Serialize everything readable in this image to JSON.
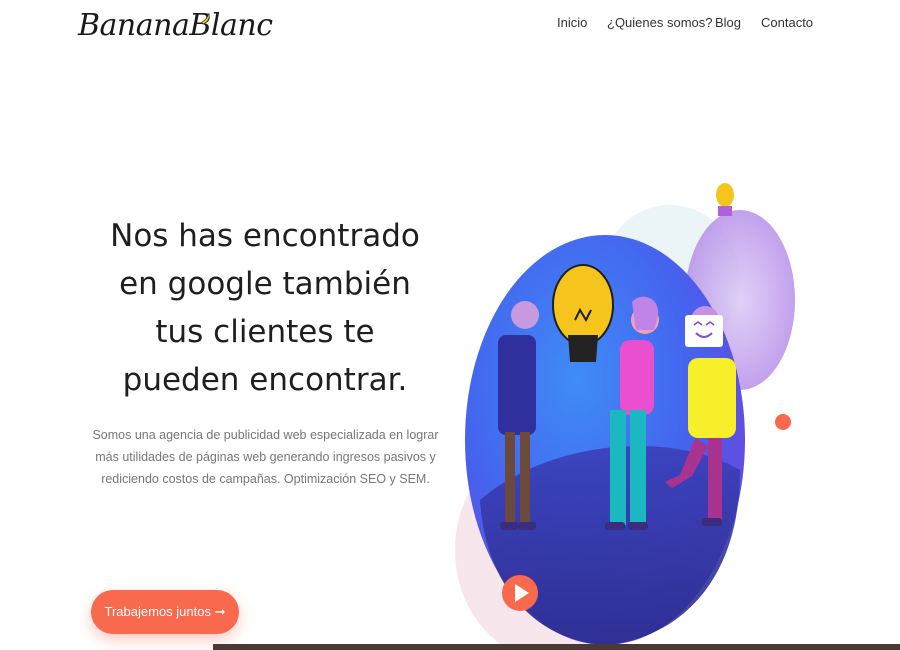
{
  "brand": {
    "logo_text": "BananaBlanc"
  },
  "nav": {
    "items": [
      {
        "label": "Inicio"
      },
      {
        "label": "¿Quienes somos?"
      },
      {
        "label": "Blog"
      },
      {
        "label": "Contacto"
      }
    ]
  },
  "hero": {
    "title": "Nos has encontrado en google también tus clientes te pueden encontrar.",
    "subtitle": "Somos una agencia de publicidad web especializada en lograr más utilidades de páginas web generando ingresos pasivos y rediciendo costos de campañas. Optimización SEO y SEM.",
    "cta_label": "Trabajemos juntos ➞"
  },
  "colors": {
    "accent": "#f9694d",
    "circle_blue": "#3f6ef0",
    "circle_purple": "#7a4fe0"
  },
  "icons": [
    "banana-icon",
    "play-icon",
    "lightbulb-icon"
  ]
}
